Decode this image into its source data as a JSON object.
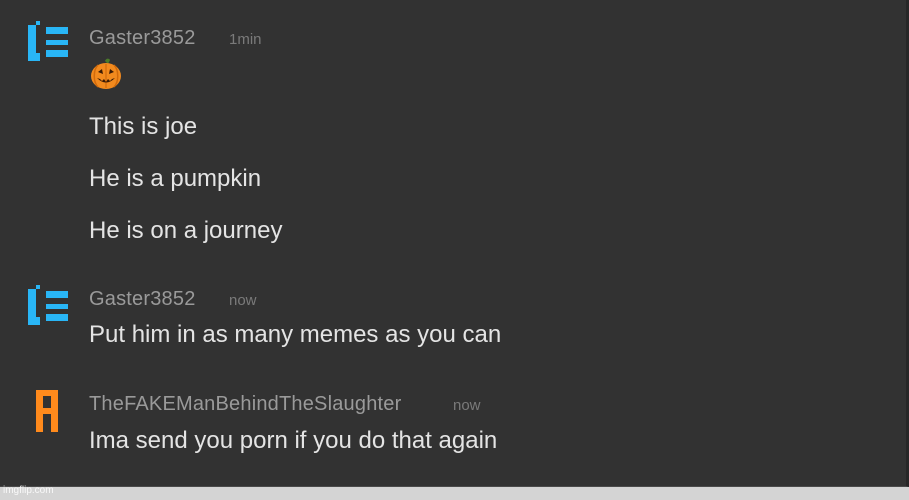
{
  "messages": [
    {
      "author": "Gaster3852",
      "time": "1min",
      "avatar_icon": "cyan-bracket-icon",
      "avatar_color": "#29b6f6",
      "emoji_icon": "jack-o-lantern-icon",
      "lines": [
        "This is joe",
        "He is a pumpkin",
        "He is on a journey"
      ]
    },
    {
      "author": "Gaster3852",
      "time": "now",
      "avatar_icon": "cyan-bracket-icon",
      "avatar_color": "#29b6f6",
      "lines": [
        "Put him in as many memes as you can"
      ]
    },
    {
      "author": "TheFAKEManBehindTheSlaughter",
      "time": "now",
      "avatar_icon": "orange-letter-a-icon",
      "avatar_color": "#ff8a1c",
      "lines": [
        "Ima send you porn if you do that again"
      ]
    }
  ],
  "colors": {
    "background": "#323232",
    "author_text": "#9a9a9a",
    "time_text": "#7a7a7a",
    "message_text": "#e4e4e4"
  },
  "watermark": "imgflip.com"
}
